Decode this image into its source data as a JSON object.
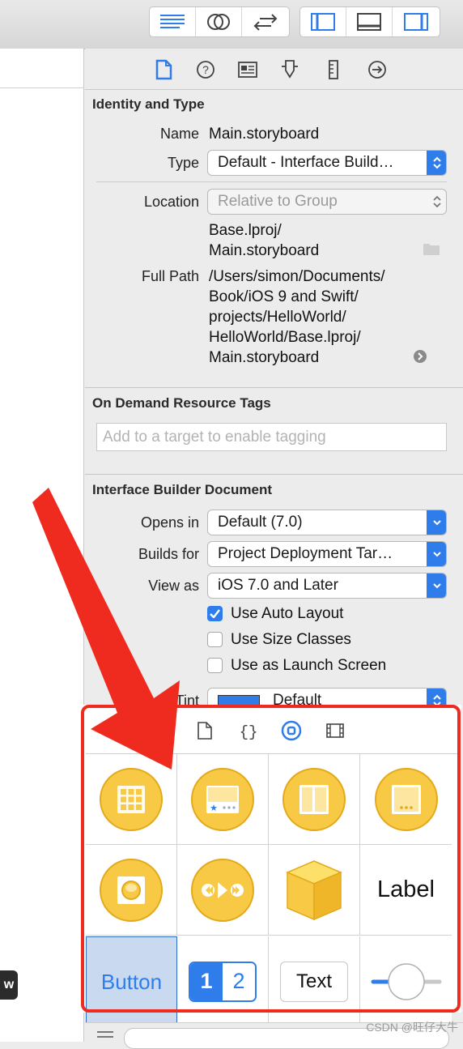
{
  "colors": {
    "accent": "#2f7dea",
    "annotation_red": "#ef2b20",
    "object_yellow": "#f7c945"
  },
  "toolbar": {
    "editor_icons": [
      "standard-editor-icon",
      "assistant-editor-icon",
      "version-editor-icon"
    ],
    "view_icons": [
      "navigator-toggle-icon",
      "debug-area-toggle-icon",
      "utilities-toggle-icon"
    ]
  },
  "inspector_tabs": [
    "file-inspector-icon",
    "quick-help-icon",
    "identity-inspector-icon",
    "attributes-inspector-icon",
    "size-inspector-icon",
    "connections-inspector-icon"
  ],
  "identity": {
    "section_title": "Identity and Type",
    "name_label": "Name",
    "name_value": "Main.storyboard",
    "type_label": "Type",
    "type_value": "Default - Interface Build…",
    "location_label": "Location",
    "location_value": "Relative to Group",
    "location_path_1": "Base.lproj/",
    "location_path_2": "Main.storyboard",
    "full_path_label": "Full Path",
    "full_path_lines": [
      "/Users/simon/Documents/",
      "Book/iOS 9 and Swift/",
      "projects/HelloWorld/",
      "HelloWorld/Base.lproj/",
      "Main.storyboard"
    ]
  },
  "on_demand": {
    "section_title": "On Demand Resource Tags",
    "placeholder": "Add to a target to enable tagging"
  },
  "ib_document": {
    "section_title": "Interface Builder Document",
    "opens_in_label": "Opens in",
    "opens_in_value": "Default (7.0)",
    "builds_for_label": "Builds for",
    "builds_for_value": "Project Deployment Tar…",
    "view_as_label": "View as",
    "view_as_value": "iOS 7.0 and Later",
    "use_auto_layout": "Use Auto Layout",
    "use_size_classes": "Use Size Classes",
    "use_launch_screen": "Use as Launch Screen",
    "global_tint_label_partial": "al Tint",
    "global_tint_value": "Default"
  },
  "library": {
    "tab_icons": [
      "file-template-icon",
      "code-snippet-icon",
      "object-library-icon",
      "media-library-icon"
    ],
    "items": {
      "label_text": "Label",
      "button_text": "Button",
      "segment_1": "1",
      "segment_2": "2",
      "textfield_text": "Text"
    }
  },
  "left_pane": {
    "badge_text": "w"
  },
  "watermark": "CSDN @旺仔大牛"
}
